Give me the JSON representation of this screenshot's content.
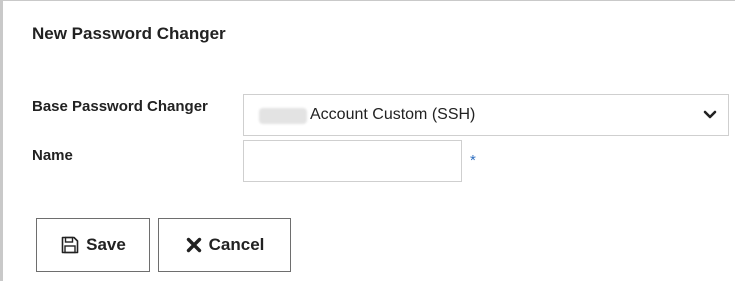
{
  "form": {
    "title": "New Password Changer",
    "base_label": "Base Password Changer",
    "base_value": "Account Custom (SSH)",
    "name_label": "Name",
    "name_value": "",
    "required_marker": "*"
  },
  "buttons": {
    "save_label": "Save",
    "cancel_label": "Cancel"
  },
  "icons": {
    "save": "floppy-disk-icon",
    "cancel": "x-icon",
    "dropdown": "chevron-down-icon"
  },
  "colors": {
    "required": "#2f6fc0",
    "border": "#cfcfcf"
  }
}
